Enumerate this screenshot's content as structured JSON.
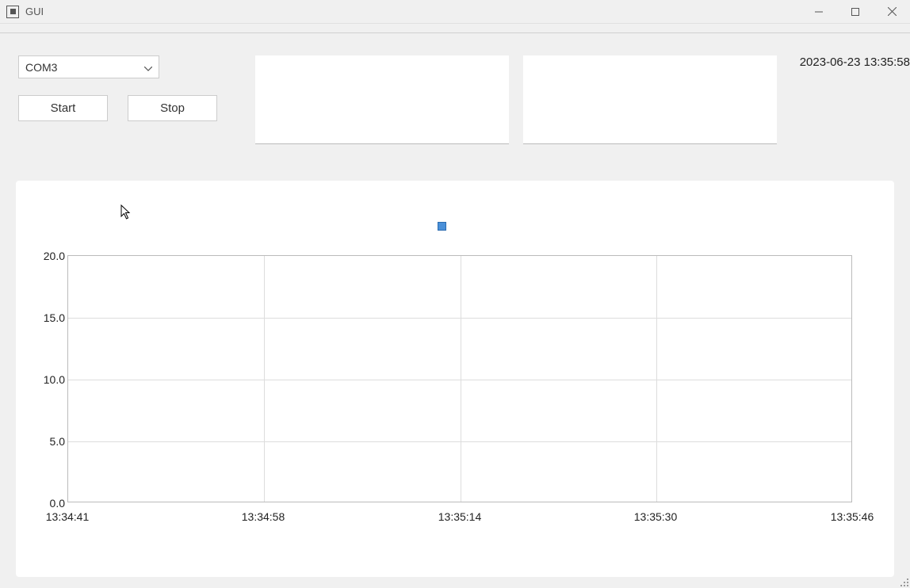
{
  "window": {
    "title": "GUI"
  },
  "controls": {
    "port_selected": "COM3",
    "start_label": "Start",
    "stop_label": "Stop"
  },
  "status": {
    "timestamp": "2023-06-23 13:35:58"
  },
  "chart_data": {
    "type": "line",
    "x_ticks": [
      "13:34:41",
      "13:34:58",
      "13:35:14",
      "13:35:30",
      "13:35:46"
    ],
    "y_ticks": [
      "0.0",
      "5.0",
      "10.0",
      "15.0",
      "20.0"
    ],
    "ylim": [
      0.0,
      20.0
    ],
    "series": [
      {
        "name": "",
        "values": []
      }
    ],
    "legend_marker_color": "#4a90d9"
  }
}
